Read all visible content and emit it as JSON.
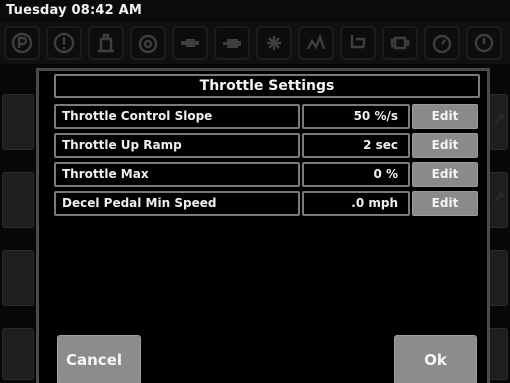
{
  "status_bar": {
    "clock": "Tuesday 08:42 AM"
  },
  "telltales": [
    {
      "icon": "parking-brake-icon"
    },
    {
      "icon": "warning-triangle-icon"
    },
    {
      "icon": "fuel-filter-icon"
    },
    {
      "icon": "engine-coolant-icon"
    },
    {
      "icon": "transmission-icon"
    },
    {
      "icon": "engine-oil-icon"
    },
    {
      "icon": "air-filter-icon"
    },
    {
      "icon": "regen-icon"
    },
    {
      "icon": "hydraulic-icon"
    },
    {
      "icon": "engine-check-icon"
    },
    {
      "icon": "gauge-icon"
    }
  ],
  "dialog": {
    "title": "Throttle Settings",
    "rows": [
      {
        "label": "Throttle Control Slope",
        "value": "50 %/s",
        "edit": "Edit"
      },
      {
        "label": "Throttle Up Ramp",
        "value": "2 sec",
        "edit": "Edit"
      },
      {
        "label": "Throttle Max",
        "value": "0 %",
        "edit": "Edit"
      },
      {
        "label": "Decel Pedal Min Speed",
        "value": ".0 mph",
        "edit": "Edit"
      }
    ],
    "cancel_label": "Cancel",
    "ok_label": "Ok"
  },
  "colors": {
    "background": "#000000",
    "border": "#7a7a7a",
    "button": "#8a8a8a",
    "text": "#f4f4f4"
  }
}
